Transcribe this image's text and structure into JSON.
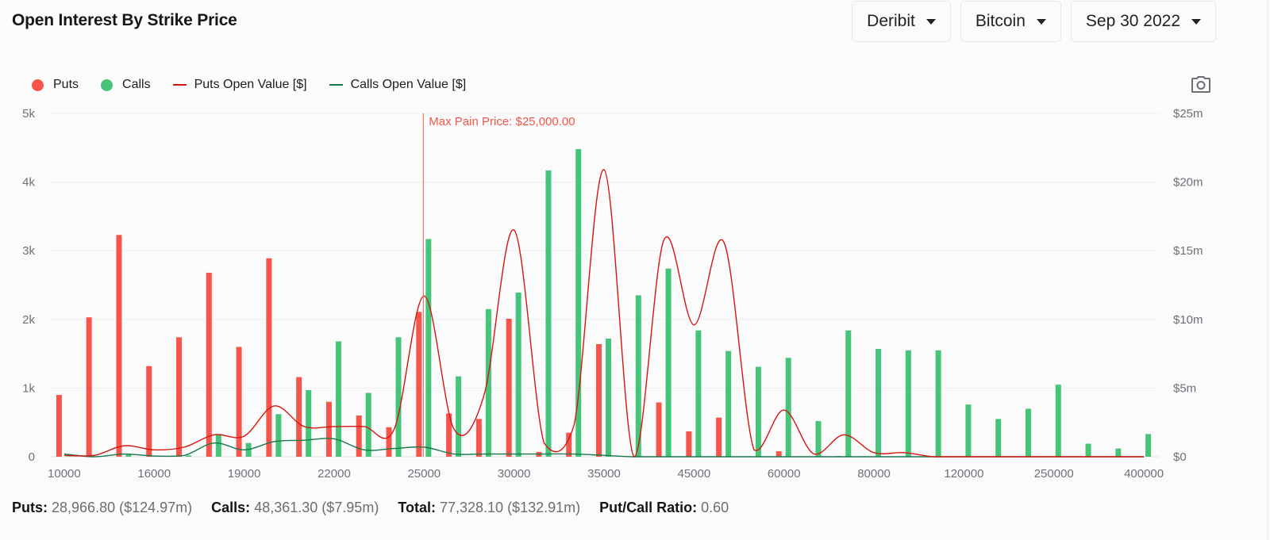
{
  "page": {
    "title": "Open Interest By Strike Price"
  },
  "selectors": [
    {
      "label": "Deribit"
    },
    {
      "label": "Bitcoin"
    },
    {
      "label": "Sep 30 2022"
    }
  ],
  "icons": {
    "camera": "camera-icon",
    "dropdown": "caret-down-icon"
  },
  "colors": {
    "puts": "#f5554a",
    "calls": "#45c47a",
    "puts_line": "#d6150f",
    "calls_line": "#17784a",
    "max_pain": "#f2564a",
    "grid": "#eeeff1",
    "axis_text": "#6d7078"
  },
  "chart_data": {
    "type": "bar",
    "title": "Open Interest By Strike Price",
    "xlabel": "",
    "ylabel": "",
    "legend": [
      "Puts",
      "Calls",
      "Puts Open Value [$]",
      "Calls Open Value [$]"
    ],
    "legend_position": "top-left",
    "grid": true,
    "categories": [
      "10000",
      "",
      "",
      "16000",
      "",
      "",
      "19000",
      "",
      "",
      "22000",
      "",
      "",
      "25000",
      "",
      "",
      "30000",
      "",
      "",
      "35000",
      "",
      "",
      "45000",
      "",
      "",
      "60000",
      "",
      "",
      "80000",
      "",
      "",
      "120000",
      "",
      "",
      "250000",
      "",
      "",
      "400000"
    ],
    "y_left": {
      "ticks": [
        "0",
        "1k",
        "2k",
        "3k",
        "4k",
        "5k"
      ],
      "range": [
        0,
        5000
      ]
    },
    "y_right": {
      "ticks": [
        "$0",
        "$5m",
        "$10m",
        "$15m",
        "$20m",
        "$25m"
      ],
      "range": [
        0,
        25
      ]
    },
    "series": [
      {
        "name": "Puts",
        "type": "bar",
        "axis": "left",
        "values": [
          900,
          2030,
          3230,
          1320,
          1740,
          2680,
          1600,
          2890,
          1160,
          800,
          600,
          430,
          2110,
          630,
          550,
          2010,
          70,
          350,
          1640,
          0,
          790,
          370,
          570,
          0,
          80,
          0,
          10,
          0,
          0,
          0,
          0,
          0,
          0,
          0,
          0,
          0,
          0
        ]
      },
      {
        "name": "Calls",
        "type": "bar",
        "axis": "left",
        "values": [
          5,
          0,
          30,
          0,
          20,
          330,
          200,
          620,
          970,
          1680,
          930,
          1740,
          3170,
          1170,
          2150,
          2390,
          4170,
          4480,
          1720,
          2350,
          2740,
          1840,
          1540,
          1310,
          1440,
          520,
          1840,
          1570,
          1550,
          1550,
          760,
          550,
          700,
          1050,
          190,
          120,
          330
        ]
      },
      {
        "name": "Puts Open Value [$]",
        "type": "line",
        "axis": "right",
        "unit": "$m",
        "values": [
          0.1,
          0.1,
          0.8,
          0.5,
          0.7,
          1.6,
          1.5,
          3.7,
          2.2,
          2.2,
          2.2,
          2.0,
          11.7,
          2.0,
          4.5,
          16.5,
          1.0,
          2.3,
          20.9,
          0.0,
          15.8,
          9.6,
          15.6,
          0.5,
          3.4,
          0.2,
          1.6,
          0.3,
          0.3,
          0.0,
          0.0,
          0.0,
          0.0,
          0.0,
          0.0,
          0.0,
          0.0
        ]
      },
      {
        "name": "Calls Open Value [$]",
        "type": "line",
        "axis": "right",
        "unit": "$m",
        "values": [
          0.2,
          0.0,
          0.2,
          0.05,
          0.1,
          1.0,
          0.5,
          1.1,
          1.2,
          1.3,
          0.5,
          0.6,
          0.7,
          0.2,
          0.2,
          0.2,
          0.2,
          0.2,
          0.1,
          0.0,
          0.0,
          0.0,
          0.0,
          0.0,
          0.0,
          0.0,
          0.0,
          0.0,
          0.0,
          0.0,
          0.0,
          0.0,
          0.0,
          0.0,
          0.0,
          0.0,
          0.0
        ]
      }
    ],
    "annotations": [
      {
        "type": "vline",
        "category_index": 12,
        "label": "Max Pain Price: $25,000.00"
      }
    ]
  },
  "stats": [
    {
      "label": "Puts:",
      "value": "28,966.80 ($124.97m)"
    },
    {
      "label": "Calls:",
      "value": "48,361.30 ($7.95m)"
    },
    {
      "label": "Total:",
      "value": "77,328.10 ($132.91m)"
    },
    {
      "label": "Put/Call Ratio:",
      "value": "0.60"
    }
  ]
}
